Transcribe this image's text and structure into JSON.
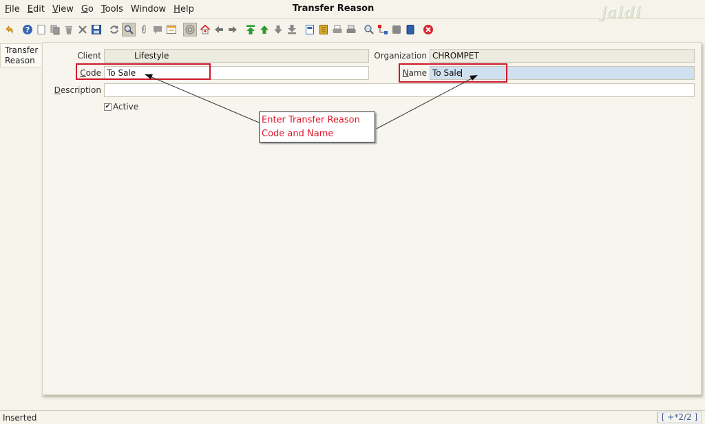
{
  "menu": {
    "items": [
      {
        "label": "File",
        "mnemonic": "F",
        "rest": "ile"
      },
      {
        "label": "Edit",
        "mnemonic": "E",
        "rest": "dit"
      },
      {
        "label": "View",
        "mnemonic": "V",
        "rest": "iew"
      },
      {
        "label": "Go",
        "mnemonic": "G",
        "rest": "o"
      },
      {
        "label": "Tools",
        "mnemonic": "T",
        "rest": "ools"
      },
      {
        "label": "Window",
        "mnemonic": "",
        "rest": "Window"
      },
      {
        "label": "Help",
        "mnemonic": "H",
        "rest": "elp"
      }
    ]
  },
  "window": {
    "title": "Transfer Reason",
    "logo_text": "jaldi"
  },
  "toolbar": {
    "icons": [
      "undo-icon",
      "help-icon",
      "new-record-icon",
      "copy-record-icon",
      "delete-icon",
      "delete-selection-icon",
      "save-icon",
      "refresh-icon",
      "find-icon",
      "attachment-icon",
      "chat-icon",
      "grid-toggle-icon",
      "history-icon",
      "home-icon",
      "back-icon",
      "forward-icon",
      "first-record-icon",
      "previous-record-icon",
      "next-record-icon",
      "last-record-icon",
      "report-icon",
      "archive-icon",
      "print-preview-icon",
      "print-icon",
      "zoom-across-icon",
      "workflow-icon",
      "request-icon",
      "product-info-icon",
      "close-window-icon"
    ]
  },
  "tab": {
    "label_line1": "Transfer",
    "label_line2": "Reason"
  },
  "form": {
    "client_label": "Client",
    "client_value": "Lifestyle",
    "organization_label": "Organization",
    "organization_value": "CHROMPET",
    "code_label_mnemonic": "C",
    "code_label_rest": "ode",
    "code_value": "To Sale",
    "name_label_mnemonic": "N",
    "name_label_rest": "ame",
    "name_value": "To Sale",
    "description_label_mnemonic": "D",
    "description_label_rest": "escription",
    "description_value": "",
    "active_label": "Active",
    "active_checked": "✔"
  },
  "annotation": {
    "line1": "Enter Transfer Reason",
    "line2": "Code and Name",
    "color": "#e0162b"
  },
  "status": {
    "text": "Inserted",
    "record_count": "[ +*2/2 ]"
  }
}
